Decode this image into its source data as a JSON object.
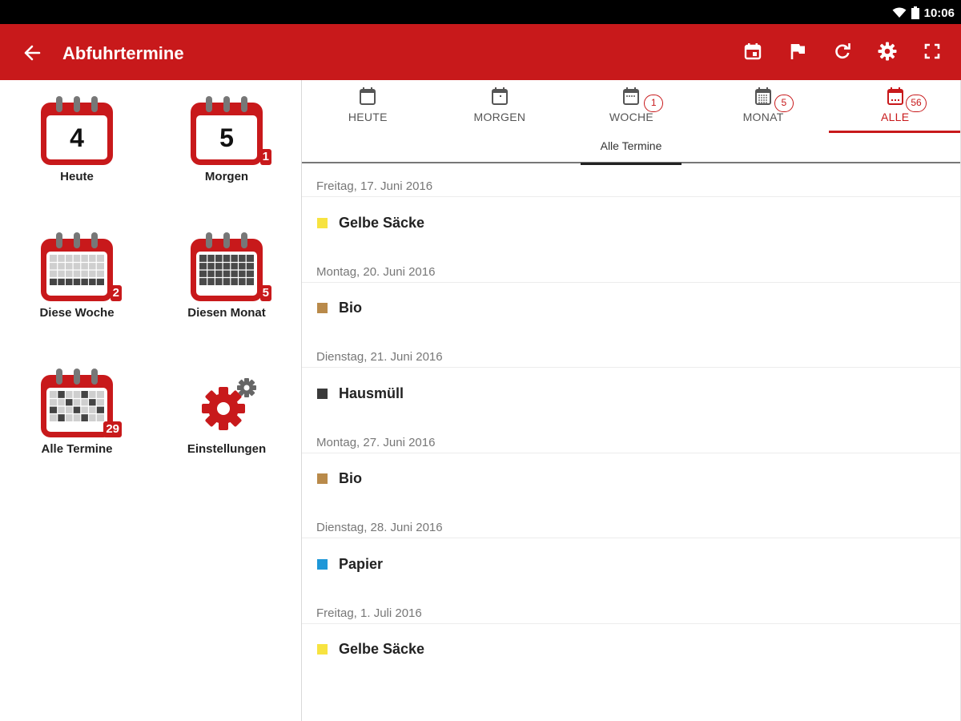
{
  "status": {
    "time": "10:06"
  },
  "appbar": {
    "title": "Abfuhrtermine",
    "actions": [
      "calendar-event-icon",
      "flag-icon",
      "refresh-icon",
      "settings-icon",
      "fullscreen-icon"
    ]
  },
  "colors": {
    "primary": "#c8191b"
  },
  "left": {
    "tiles": [
      {
        "label": "Heute",
        "day": "4",
        "badge": ""
      },
      {
        "label": "Morgen",
        "day": "5",
        "badge": "1"
      },
      {
        "label": "Diese Woche",
        "badge": "2"
      },
      {
        "label": "Diesen Monat",
        "badge": "5"
      },
      {
        "label": "Alle Termine",
        "badge": "29"
      },
      {
        "label": "Einstellungen"
      }
    ]
  },
  "tabs": [
    {
      "label": "HEUTE",
      "count": ""
    },
    {
      "label": "MORGEN",
      "count": ""
    },
    {
      "label": "WOCHE",
      "count": "1"
    },
    {
      "label": "MONAT",
      "count": "5"
    },
    {
      "label": "ALLE",
      "count": "56"
    }
  ],
  "active_tab": "ALLE",
  "subtab": {
    "label": "Alle Termine"
  },
  "events": [
    {
      "date": "Freitag, 17. Juni 2016",
      "name": "Gelbe Säcke",
      "color": "#f7e340"
    },
    {
      "date": "Montag, 20. Juni 2016",
      "name": "Bio",
      "color": "#b98a4a"
    },
    {
      "date": "Dienstag, 21. Juni 2016",
      "name": "Hausmüll",
      "color": "#3a3a3a"
    },
    {
      "date": "Montag, 27. Juni 2016",
      "name": "Bio",
      "color": "#b98a4a"
    },
    {
      "date": "Dienstag, 28. Juni 2016",
      "name": "Papier",
      "color": "#1e97d8"
    },
    {
      "date": "Freitag, 1. Juli 2016",
      "name": "Gelbe Säcke",
      "color": "#f7e340"
    }
  ]
}
